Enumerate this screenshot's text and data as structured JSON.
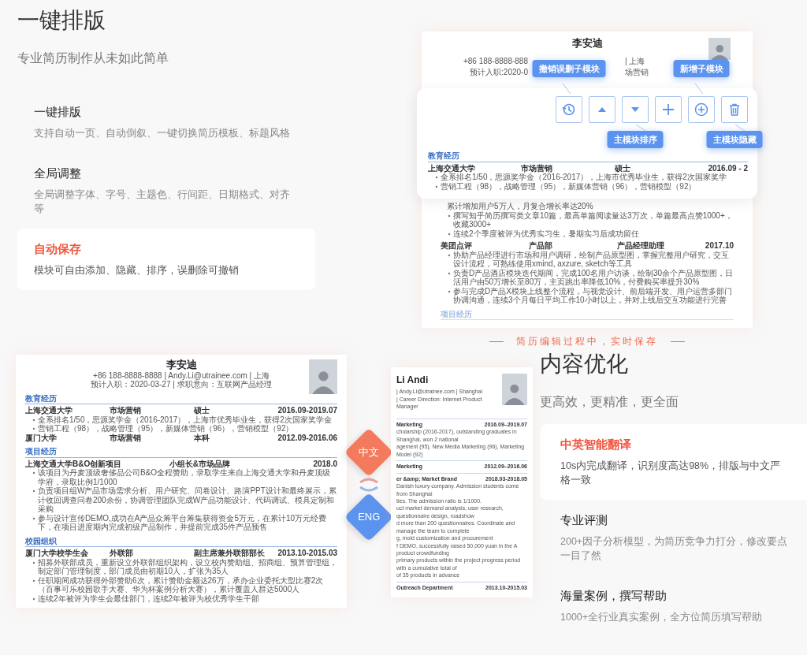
{
  "layout_section": {
    "title": "一键排版",
    "subtitle": "专业简历制作从未如此简单",
    "features": [
      {
        "title": "一键排版",
        "description": "支持自动一页、自动倒叙、一键切换简历模板、标题风格",
        "selected": false
      },
      {
        "title": "全局调整",
        "description": "全局调整字体、字号、主题色、行间距、日期格式、对齐等",
        "selected": false
      },
      {
        "title": "自动保存",
        "description": "模块可自由添加、隐藏、排序，误删除可撤销",
        "selected": true
      }
    ]
  },
  "editor_demo": {
    "name": "李安迪",
    "contact_line_1": [
      "+86 188-8888-888",
      "| 上海"
    ],
    "contact_line_2": [
      "预计入职:2020-0",
      "场营销"
    ],
    "toolbar": [
      {
        "kind": "history",
        "tooltip_above": "撤销误删子模块"
      },
      {
        "kind": "up"
      },
      {
        "kind": "down",
        "tooltip_below": "主模块排序"
      },
      {
        "kind": "move"
      },
      {
        "kind": "add",
        "tooltip_above": "新增子模块"
      },
      {
        "kind": "delete",
        "tooltip_below": "主模块隐藏"
      }
    ],
    "education": {
      "heading": "教育经历",
      "cells": [
        "上海交通大学",
        "市场营销",
        "硕士",
        "2016.09 - 2"
      ],
      "bullets": [
        "全系排名1/50，思源奖学金（2016-2017），上海市优秀毕业生，获得2次国家奖学",
        "营销工程（98），战略管理（95），新媒体营销（96），营销模型（92）"
      ]
    },
    "continued_text": "累计增加用户5万人，月复合增长率达20%",
    "bullets": [
      "撰写知乎简历撰写类文章10篇，最高单篇阅读量达3万次，单篇最高点赞1000+，收藏3000+",
      "连续2个季度被评为优秀实习生，暑期实习后成功留任"
    ],
    "job": {
      "cells": [
        "美团点评",
        "产品部",
        "产品经理助理",
        "2017.10"
      ],
      "bullets": [
        "协助产品经理进行市场和用户调研，绘制产品原型图，掌握完整用户研究，交互设计流程，可熟练使用xmind, axzure, sketch等工具",
        "负责D产品酒店模块迭代期间，完成100名用户访谈，绘制30余个产品原型图，日活用户由50万增长至80万，主页跳出率降低10%，付费购买率提升30%",
        "参与完成D产品X模块上线整个流程，与视觉设计、前后端开发、用户运营多部门协调沟通，连续3个月每日平均工作10小时以上，并对上线后交互功能进行完善"
      ]
    },
    "next_heading": "项目经历",
    "caption": "简历编辑过程中，实时保存"
  },
  "translation_demo": {
    "chinese_resume": {
      "name": "李安迪",
      "contact": [
        "+86 188-8888-8888 | Andy.Li@utrainee.com | 上海",
        "预计入职：2020-03-27 | 求职意向：互联网产品经理"
      ],
      "sections": [
        {
          "heading": "教育经历",
          "entries": [
            {
              "cells": [
                "上海交通大学",
                "市场营销",
                "硕士",
                "2016.09-2019.07"
              ],
              "bullets": [
                "全系排名1/50，思源奖学金（2016-2017），上海市优秀毕业生，获得2次国家奖学金",
                "营销工程（98），战略管理（95），新媒体营销（96），营销模型（92）"
              ]
            },
            {
              "cells": [
                "厦门大学",
                "市场营销",
                "本科",
                "2012.09-2016.06"
              ]
            }
          ]
        },
        {
          "heading": "项目经历",
          "entries": [
            {
              "cells": [
                "上海交通大学B&O创新项目",
                "小组长&市场品牌",
                "2018.0"
              ],
              "bullets": [
                "该项目为丹麦顶级奢侈品公司B&O全程赞助，录取学生来自上海交通大学和丹麦顶级学府，录取比例1/1000",
                "负责项目组W产品市场需求分析、用户研究、问卷设计、路演PPT设计和最终展示，累计收回调查问卷200余份，协调管理团队完成W产品功能设计、代码调试、模具定制和采购",
                "参与设计宣传DEMO,成功在A产品众筹平台筹集获得资金5万元，在累计10万元经费下，在项目进度期内完成初级产品制作，并提前完成35件产品预售"
              ]
            }
          ]
        },
        {
          "heading": "校园组织",
          "entries": [
            {
              "cells": [
                "厦门大学校学生会",
                "外联部",
                "副主席兼外联部部长",
                "2013.10-2015.03"
              ],
              "bullets": [
                "招募外联部成员，重新设立外联部组织架构，设立校内赞助组、招商组、预算管理组，制定部门管理制度，部门成员由初期10人，扩张为35人",
                "任职期间成功获得外部赞助6次，累计赞助金额达26万，承办企业委托大型比赛2次（百事可乐校园歌手大赛、华为杯案例分析大赛），累计覆盖人群达5000人",
                "连续2年被评为学生会最佳部门，连续2年被评为校优秀学生干部"
              ]
            }
          ]
        }
      ]
    },
    "badges": [
      "中文",
      "ENG"
    ],
    "english_resume": {
      "name": "Li Andi",
      "contact": [
        "| Andy.Li@utrainee.com | Shanghai",
        "| Career Direction: Internet Product Manager"
      ],
      "lines": [
        {
          "kind": "row",
          "cells": [
            "Marketing",
            "2016.09–2019.07"
          ]
        },
        {
          "kind": "text",
          "text": "cholarship (2016-2017), outstanding graduates in Shanghai, won 2 national"
        },
        {
          "kind": "text",
          "text": "agement (95), New Media Marketing (96), Marketing Model (92)"
        },
        {
          "kind": "row",
          "cells": [
            "Marketing",
            "2012.09–2016.06"
          ]
        },
        {
          "kind": "row",
          "cells": [
            "er &amp; Market Brand",
            "2018.03-2018.05"
          ]
        },
        {
          "kind": "text",
          "text": "Danish luxury company. Admission students come from Shanghai"
        },
        {
          "kind": "text",
          "text": "ties. The admission ratio is 1/1000."
        },
        {
          "kind": "text",
          "text": "uct market demand analysis, user research, questionnaire design, roadshow"
        },
        {
          "kind": "text",
          "text": "d more than 200 questionnaires. Coordinate and manage the team to complete"
        },
        {
          "kind": "text",
          "text": "g, mold customization and procurement"
        },
        {
          "kind": "text",
          "text": "f DEMO, successfully raised 50,000 yuan in the A product crowdfunding"
        },
        {
          "kind": "text",
          "text": "primary products within the project progress period with a cumulative total of"
        },
        {
          "kind": "text",
          "text": "of 35 products in advance"
        },
        {
          "kind": "row",
          "cells": [
            "Outreach Department",
            "2013.10-2015.03"
          ]
        }
      ]
    }
  },
  "content_section": {
    "title": "内容优化",
    "subtitle": "更高效，更精准，更全面",
    "features": [
      {
        "title": "中英智能翻译",
        "description": "10s内完成翻译，识别度高达98%，排版与中文严格一致",
        "selected": true
      },
      {
        "title": "专业评测",
        "description": "200+因子分析模型，为简历竞争力打分，修改要点一目了然",
        "selected": false
      },
      {
        "title": "海量案例，撰写帮助",
        "description": "1000+全行业真实案例，全方位简历填写帮助",
        "selected": false
      }
    ]
  }
}
